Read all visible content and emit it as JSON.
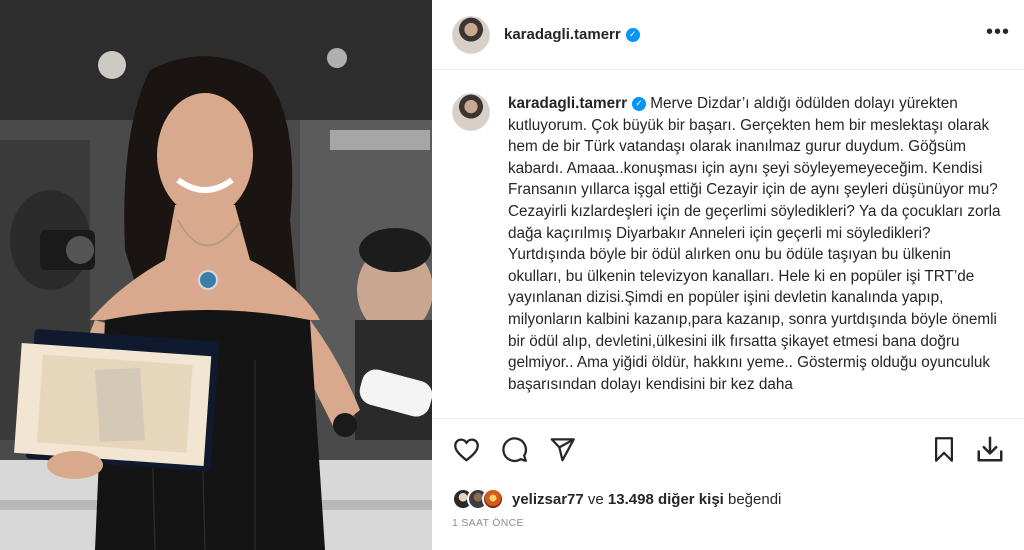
{
  "header": {
    "username": "karadagli.tamerr",
    "verified": true,
    "more_label": "•••"
  },
  "caption": {
    "username": "karadagli.tamerr",
    "text": " Merve Dizdar’ı aldığı ödülden dolayı yürekten kutluyorum. Çok büyük bir başarı. Gerçekten hem bir meslektaşı olarak hem de bir Türk vatandaşı olarak inanılmaz gurur duydum. Göğsüm kabardı. Amaaa..konuşması için aynı şeyi söyleyemeyeceğim. Kendisi Fransanın yıllarca işgal ettiği Cezayir için de aynı şeyleri düşünüyor mu? Cezayirli kızlardeşleri için de geçerlimi söyledikleri? Ya da çocukları zorla dağa kaçırılmış Diyarbakır Anneleri için geçerli mi söyledikleri? Yurtdışında böyle bir ödül alırken onu bu ödüle taşıyan bu ülkenin okulları, bu ülkenin televizyon kanalları. Hele ki en popüler işi TRT’de yayınlanan dizisi.Şimdi en popüler işini devletin kanalında yapıp, milyonların kalbini kazanıp,para kazanıp, sonra yurtdışında böyle önemli bir ödül alıp, devletini,ülkesini ilk fırsatta şikayet etmesi bana doğru gelmiyor.. Ama yiğidi öldür, hakkını yeme.. Göstermiş olduğu oyunculuk başarısından dolayı kendisini bir kez daha"
  },
  "actions": {
    "like_icon": "heart-icon",
    "comment_icon": "comment-icon",
    "share_icon": "send-icon",
    "save_icon": "bookmark-icon",
    "download_icon": "download-icon"
  },
  "likes": {
    "first_liker": "yelizsar77",
    "connector": " ve ",
    "others": "13.498 diğer kişi",
    "suffix": " beğendi"
  },
  "time": "1 SAAT ÖNCE",
  "colors": {
    "verified": "#0095f6",
    "text": "#262626",
    "muted": "#8e8e8e",
    "border": "#efefef"
  }
}
